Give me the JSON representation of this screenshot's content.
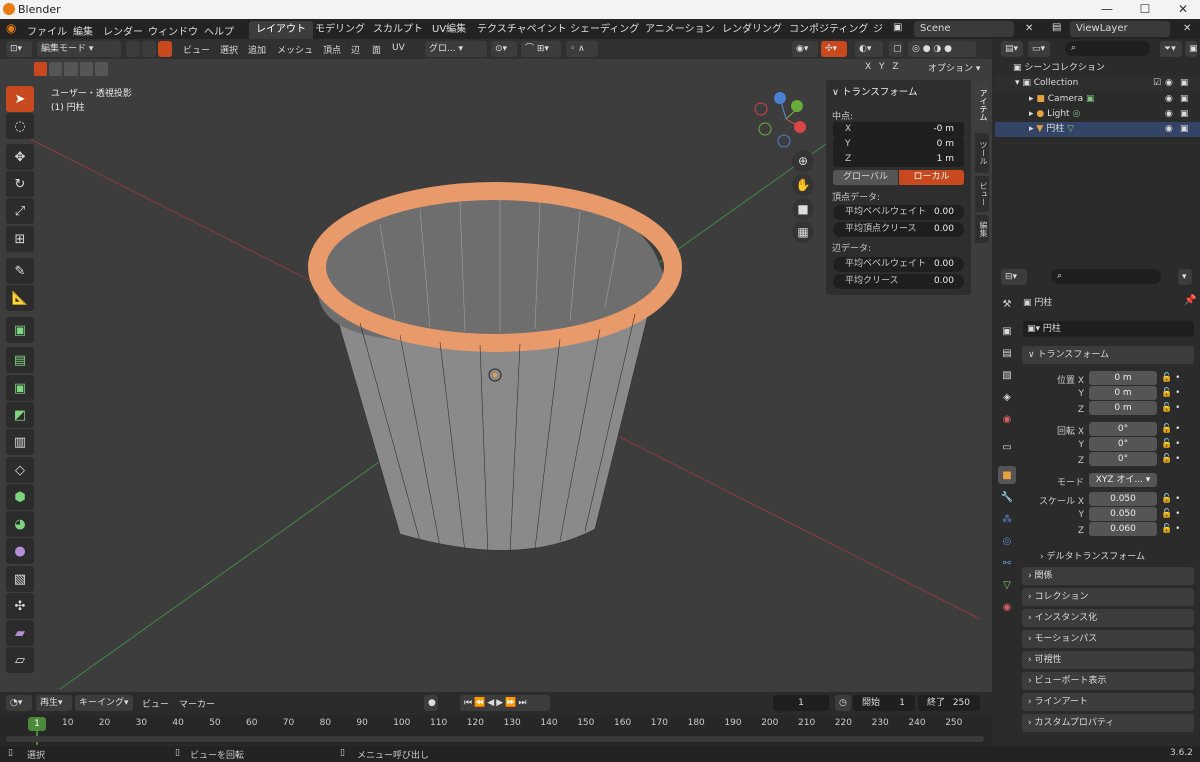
{
  "app": {
    "title": "Blender"
  },
  "window_buttons": {
    "minimize": "—",
    "maximize": "☐",
    "close": "✕"
  },
  "menus": [
    "ファイル",
    "編集",
    "レンダー",
    "ウィンドウ",
    "ヘルプ"
  ],
  "workspaces": [
    {
      "label": "レイアウト",
      "active": true
    },
    {
      "label": "モデリング",
      "active": false
    },
    {
      "label": "スカルプト",
      "active": false
    },
    {
      "label": "UV編集",
      "active": false
    },
    {
      "label": "テクスチャペイント",
      "active": false
    },
    {
      "label": "シェーディング",
      "active": false
    },
    {
      "label": "アニメーション",
      "active": false
    },
    {
      "label": "レンダリング",
      "active": false
    },
    {
      "label": "コンポジティング",
      "active": false
    },
    {
      "label": "ジ",
      "active": false
    }
  ],
  "scene": {
    "name": "Scene",
    "view_layer": "ViewLayer"
  },
  "vheader": {
    "mode": "編集モード",
    "menus": [
      "ビュー",
      "選択",
      "追加",
      "メッシュ",
      "頂点",
      "辺",
      "面",
      "UV"
    ],
    "orientation": "グロ...",
    "options": "オプション",
    "axes": [
      "X",
      "Y",
      "Z"
    ]
  },
  "viewport": {
    "view_name": "ユーザー・透視投影",
    "object_label": "(1) 円柱"
  },
  "npanel": {
    "header": "トランスフォーム",
    "median_label": "中点:",
    "fields": [
      {
        "label": "X",
        "value": "-0 m"
      },
      {
        "label": "Y",
        "value": "0 m"
      },
      {
        "label": "Z",
        "value": "1 m"
      }
    ],
    "global": "グローバル",
    "local": "ローカル",
    "vertex_data": "頂点データ:",
    "vertex_fields": [
      {
        "label": "平均ベベルウェイト",
        "value": "0.00"
      },
      {
        "label": "平均頂点クリース",
        "value": "0.00"
      }
    ],
    "edge_data": "辺データ:",
    "edge_fields": [
      {
        "label": "平均ベベルウェイト",
        "value": "0.00"
      },
      {
        "label": "平均クリース",
        "value": "0.00"
      }
    ],
    "tabs": [
      "アイテム",
      "ツール",
      "ビュー",
      "編集"
    ]
  },
  "outliner": {
    "scene_collection": "シーンコレクション",
    "items": [
      {
        "name": "Collection",
        "indent": 1
      },
      {
        "name": "Camera",
        "indent": 2
      },
      {
        "name": "Light",
        "indent": 2
      },
      {
        "name": "円柱",
        "indent": 2
      }
    ]
  },
  "properties": {
    "object_name": "円柱",
    "data_name": "円柱",
    "transform_header": "トランスフォーム",
    "location": {
      "label_x": "位置 X",
      "label_y": "Y",
      "label_z": "Z",
      "x": "0 m",
      "y": "0 m",
      "z": "0 m"
    },
    "rotation": {
      "label_x": "回転 X",
      "label_y": "Y",
      "label_z": "Z",
      "x": "0°",
      "y": "0°",
      "z": "0°"
    },
    "mode": {
      "label": "モード",
      "value": "XYZ オイ..."
    },
    "scale": {
      "label_x": "スケール X",
      "label_y": "Y",
      "label_z": "Z",
      "x": "0.050",
      "y": "0.050",
      "z": "0.060"
    },
    "delta": "デルタトランスフォーム",
    "sections": [
      "関係",
      "コレクション",
      "インスタンス化",
      "モーションパス",
      "可視性",
      "ビューポート表示",
      "ラインアート",
      "カスタムプロパティ"
    ]
  },
  "timeline": {
    "playback": "再生",
    "keying": "キーイング",
    "view": "ビュー",
    "marker": "マーカー",
    "current_frame": "1",
    "start_label": "開始",
    "start": "1",
    "end_label": "終了",
    "end": "250",
    "ticks": [
      "10",
      "20",
      "30",
      "40",
      "50",
      "60",
      "70",
      "80",
      "90",
      "100",
      "110",
      "120",
      "130",
      "140",
      "150",
      "160",
      "170",
      "180",
      "190",
      "200",
      "210",
      "220",
      "230",
      "240",
      "250"
    ],
    "playhead": "1"
  },
  "status": {
    "select": "選択",
    "rotate": "ビューを回転",
    "menu": "メニュー呼び出し",
    "version": "3.6.2"
  }
}
